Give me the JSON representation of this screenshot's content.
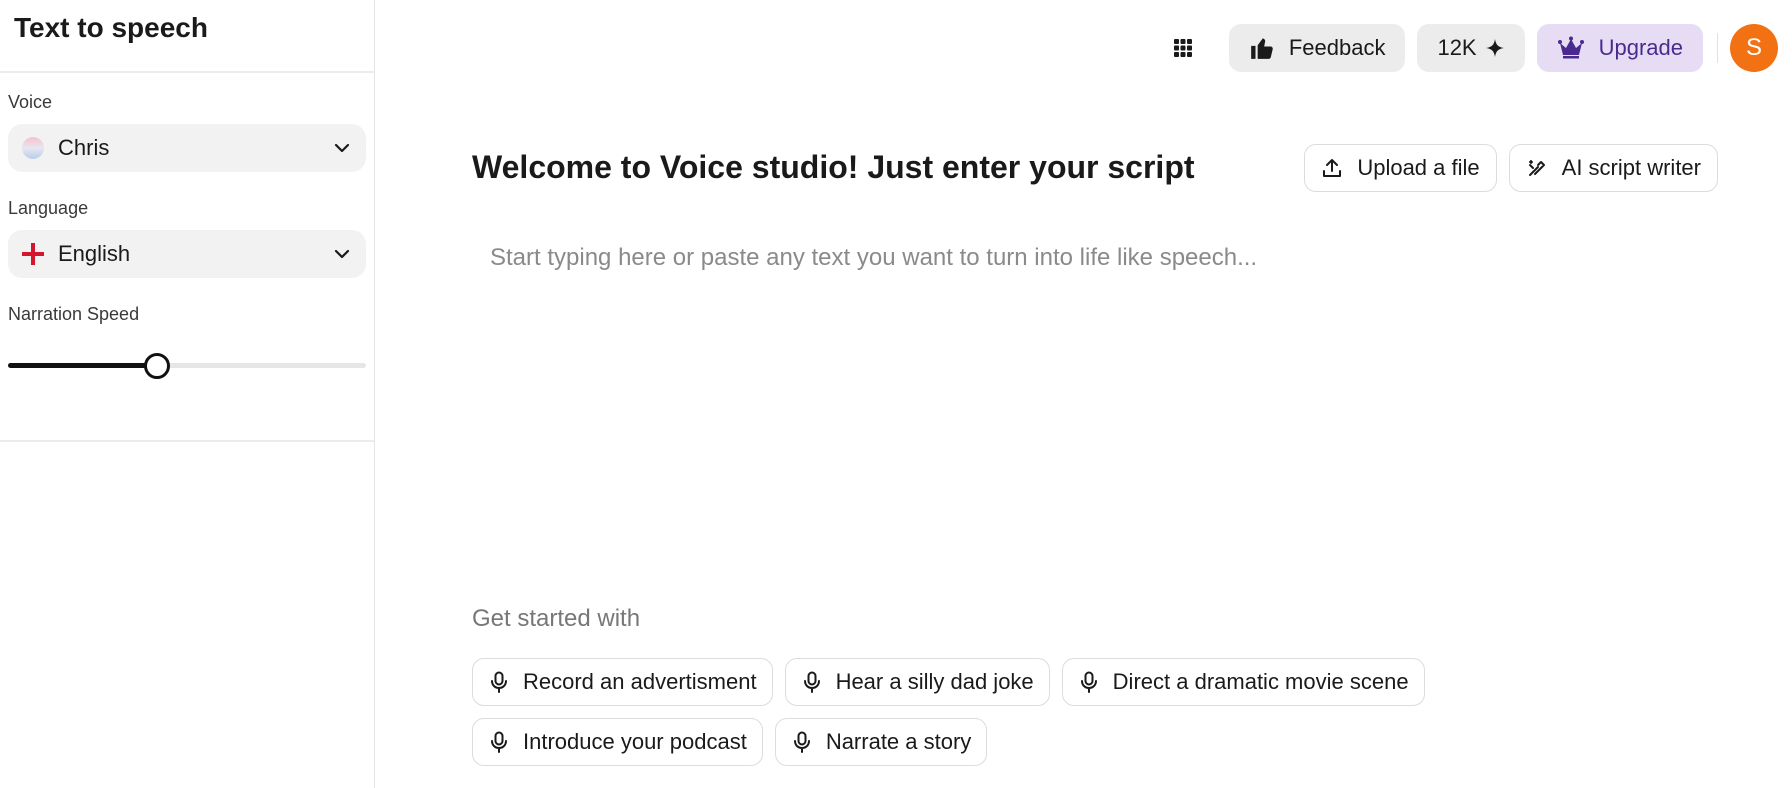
{
  "sidebar": {
    "title": "Text to speech",
    "voice": {
      "label": "Voice",
      "value": "Chris"
    },
    "language": {
      "label": "Language",
      "value": "English"
    },
    "speed": {
      "label": "Narration Speed",
      "value_fraction": 0.415
    }
  },
  "topbar": {
    "feedback_label": "Feedback",
    "credits_label": "12K",
    "upgrade_label": "Upgrade",
    "avatar_initial": "S",
    "colors": {
      "upgrade_bg": "#e6ddf5",
      "upgrade_text": "#4b2a8f",
      "avatar_bg": "#f27213"
    }
  },
  "main": {
    "title": "Welcome to Voice studio! Just enter your script",
    "upload_label": "Upload a file",
    "ai_writer_label": "AI script writer",
    "input_placeholder": "Start typing here or paste any text you want to turn into life like speech...",
    "input_value": "",
    "get_started": "Get started with",
    "suggestions": [
      {
        "label": "Record an advertisment"
      },
      {
        "label": "Hear a silly dad joke"
      },
      {
        "label": "Direct a dramatic movie scene"
      },
      {
        "label": "Introduce your podcast"
      },
      {
        "label": "Narrate a story"
      }
    ]
  }
}
